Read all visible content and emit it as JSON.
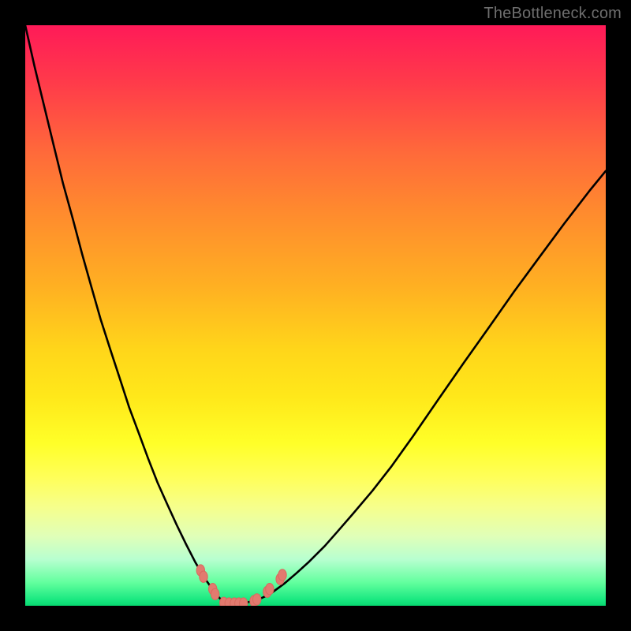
{
  "watermark": "TheBottleneck.com",
  "colors": {
    "frame": "#000000",
    "curve": "#000000",
    "bead": "#e27a6f",
    "gradient_top": "#ff1a58",
    "gradient_bottom": "#08d870"
  },
  "chart_data": {
    "type": "line",
    "title": "",
    "xlabel": "",
    "ylabel": "",
    "xlim": [
      0,
      100
    ],
    "ylim": [
      0,
      100
    ],
    "grid": false,
    "legend": false,
    "note": "Axes are unlabeled in the source image. x/y are in percent of plot area (0 = left/bottom, 100 = right/top). Values are visually estimated.",
    "series": [
      {
        "name": "curve",
        "x": [
          0.0,
          1.6,
          3.3,
          4.9,
          6.5,
          8.2,
          9.8,
          11.4,
          13.0,
          14.7,
          16.3,
          17.9,
          19.6,
          21.2,
          22.8,
          24.5,
          26.1,
          27.7,
          29.3,
          31.0,
          31.8,
          32.6,
          32.9,
          33.4,
          34.0,
          34.5,
          35.1,
          35.6,
          36.1,
          37.0,
          38.0,
          39.1,
          40.2,
          41.3,
          42.4,
          43.5,
          44.6,
          46.7,
          48.9,
          51.6,
          53.8,
          56.5,
          59.8,
          63.0,
          66.8,
          71.2,
          75.5,
          79.9,
          84.2,
          88.6,
          92.9,
          97.3,
          100.0
        ],
        "y": [
          100.0,
          92.9,
          85.9,
          79.3,
          72.8,
          66.6,
          60.6,
          54.9,
          49.3,
          44.0,
          39.1,
          34.2,
          29.6,
          25.3,
          21.2,
          17.4,
          13.9,
          10.6,
          7.5,
          4.6,
          3.5,
          2.7,
          2.0,
          1.4,
          0.8,
          0.5,
          0.4,
          0.4,
          0.4,
          0.4,
          0.5,
          0.8,
          1.1,
          1.6,
          2.2,
          3.0,
          3.8,
          5.6,
          7.6,
          10.3,
          12.8,
          15.9,
          19.8,
          23.9,
          29.2,
          35.6,
          41.8,
          48.0,
          54.1,
          60.1,
          65.9,
          71.6,
          74.9
        ]
      }
    ],
    "markers": {
      "name": "beads",
      "note": "Small pink lozenge markers near the valley of the curve.",
      "points": [
        {
          "x": 30.2,
          "y": 6.1
        },
        {
          "x": 30.7,
          "y": 5.0
        },
        {
          "x": 32.3,
          "y": 2.9
        },
        {
          "x": 32.7,
          "y": 2.0
        },
        {
          "x": 34.2,
          "y": 0.5
        },
        {
          "x": 35.1,
          "y": 0.4
        },
        {
          "x": 36.0,
          "y": 0.4
        },
        {
          "x": 36.8,
          "y": 0.4
        },
        {
          "x": 37.6,
          "y": 0.4
        },
        {
          "x": 39.4,
          "y": 0.8
        },
        {
          "x": 39.9,
          "y": 1.1
        },
        {
          "x": 41.7,
          "y": 2.4
        },
        {
          "x": 42.1,
          "y": 2.9
        },
        {
          "x": 43.9,
          "y": 4.6
        },
        {
          "x": 44.3,
          "y": 5.3
        }
      ]
    }
  }
}
